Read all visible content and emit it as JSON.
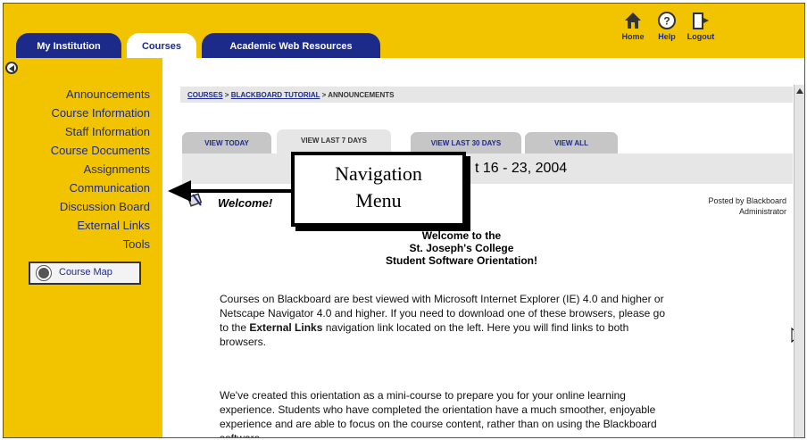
{
  "header": {
    "tabs": [
      "My Institution",
      "Courses",
      "Academic Web Resources"
    ],
    "active_tab": "Courses",
    "nav": [
      {
        "label": "Home",
        "icon": "home-icon"
      },
      {
        "label": "Help",
        "icon": "help-icon"
      },
      {
        "label": "Logout",
        "icon": "logout-icon"
      }
    ],
    "accent_color": "#f2c400",
    "tab_color": "#1c2a8a"
  },
  "sidebar": {
    "items": [
      "Announcements",
      "Course Information",
      "Staff Information",
      "Course Documents",
      "Assignments",
      "Communication",
      "Discussion Board",
      "External Links",
      "Tools"
    ],
    "course_map_label": "Course Map"
  },
  "breadcrumb": {
    "part1": "COURSES",
    "sep": ">",
    "part2": "BLACKBOARD TUTORIAL",
    "part3": "ANNOUNCEMENTS"
  },
  "announcement_tabs": {
    "today": "VIEW TODAY",
    "last7": "VIEW LAST 7 DAYS",
    "last30": "VIEW LAST 30 DAYS",
    "all": "VIEW ALL",
    "active": "VIEW LAST 7 DAYS"
  },
  "date_range": "t 16 - 23, 2004",
  "announcement": {
    "title": "Welcome!",
    "posted_by_line1": "Posted by Blackboard",
    "posted_by_line2": "Administrator",
    "heading": [
      "Welcome to the",
      "St. Joseph's College",
      "Student Software Orientation!"
    ],
    "p1_before": "Courses on Blackboard are best viewed with Microsoft Internet Explorer (IE) 4.0 and higher or Netscape Navigator 4.0 and higher. If you need to download one of these browsers, please go to the ",
    "p1_bold": "External Links",
    "p1_after": " navigation link located on the left. Here you will find links to both browsers.",
    "p2": "We've created this orientation as a mini-course to prepare you for your online learning experience. Students who have completed the orientation have a much smoother, enjoyable experience and are able to focus on the course content, rather than on using the Blackboard software."
  },
  "callout": {
    "line1": "Navigation",
    "line2": "Menu"
  }
}
